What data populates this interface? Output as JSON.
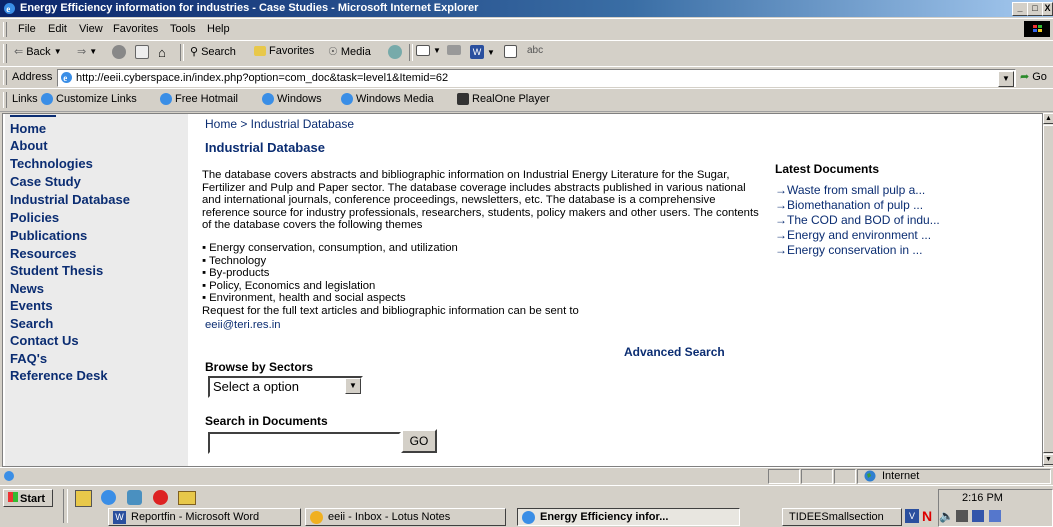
{
  "window": {
    "title": "Energy Efficiency information for industries - Case Studies - Microsoft Internet Explorer",
    "controls": [
      "_",
      "□",
      "X"
    ]
  },
  "menu": [
    "File",
    "Edit",
    "View",
    "Favorites",
    "Tools",
    "Help"
  ],
  "toolbar": {
    "back": "Back",
    "search": "Search",
    "favorites": "Favorites",
    "media": "Media"
  },
  "address": {
    "label": "Address",
    "url": "http://eeii.cyberspace.in/index.php?option=com_doc&task=level1&Itemid=62",
    "go": "Go"
  },
  "links": {
    "label": "Links",
    "items": [
      "Customize Links",
      "Free Hotmail",
      "Windows",
      "Windows Media",
      "RealOne Player"
    ]
  },
  "nav": [
    "Home",
    "About",
    "Technologies",
    "Case Study",
    "Industrial Database",
    "Policies",
    "Publications",
    "Resources",
    "Student Thesis",
    "News",
    "Events",
    "Search",
    "Contact Us",
    "FAQ's",
    "Reference Desk"
  ],
  "main": {
    "breadcrumb": "Home > Industrial Database",
    "heading": "Industrial Database",
    "description": "The database covers abstracts and bibliographic information on Industrial Energy Literature for the Sugar, Fertilizer and Pulp and Paper sector. The database coverage includes abstracts published in various national and international journals, conference proceedings, newsletters, etc. The database is a comprehensive reference source for industry professionals, researchers, students, policy makers and other users. The contents of the database covers the following themes",
    "themes": [
      "▪ Energy conservation, consumption, and utilization",
      "▪ Technology",
      "▪ By-products",
      "▪ Policy, Economics and legislation",
      "▪ Environment, health and social aspects"
    ],
    "request_text": "Request for the full text articles and bibliographic information can be sent to",
    "email": "eeii@teri.res.in",
    "advanced_search": "Advanced Search",
    "browse_label": "Browse by Sectors",
    "browse_select": "Select a option",
    "search_label": "Search in Documents",
    "search_value": "",
    "go_button": "GO"
  },
  "latest": {
    "heading": "Latest Documents",
    "items": [
      "→Waste from small pulp a...",
      "→Biomethanation of pulp ...",
      "→The COD and BOD of indu...",
      "→Energy and environment ...",
      "→Energy conservation in ..."
    ]
  },
  "status": {
    "zone": "Internet"
  },
  "taskbar": {
    "start": "Start",
    "tasks": [
      "Reportfin - Microsoft Word",
      "eeii - Inbox - Lotus Notes",
      "Energy Efficiency infor...",
      "TIDEESmallsection"
    ],
    "clock": "2:16 PM"
  },
  "colors": {
    "title_bar": "#0a246a",
    "link": "#0b2d72",
    "chrome": "#d4d0c8"
  }
}
